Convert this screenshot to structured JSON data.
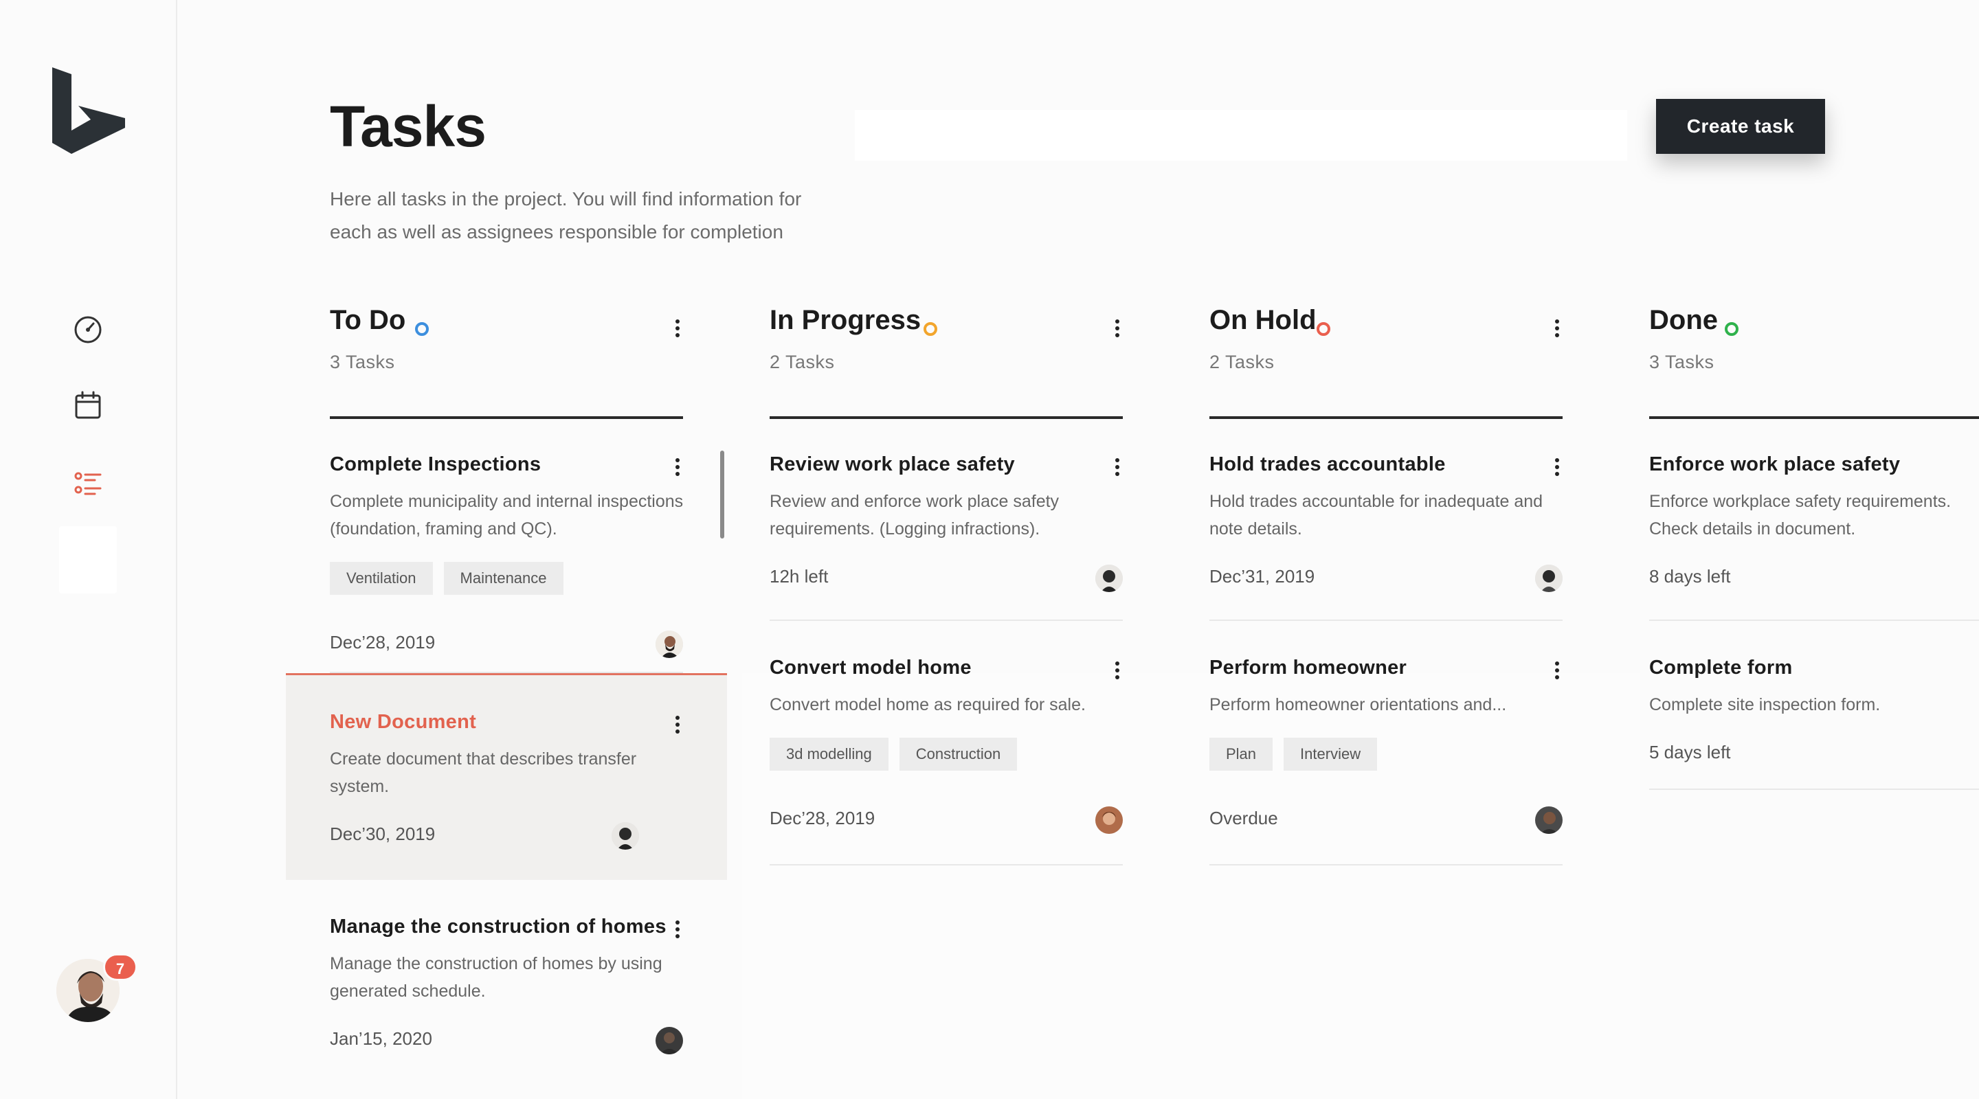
{
  "colors": {
    "accent": "#e2624e",
    "todo": "#3d8fde",
    "in_progress": "#f2a52c",
    "on_hold": "#ea5f4e",
    "done": "#2fb24c",
    "button": "#22262b"
  },
  "sidebar": {
    "icons": [
      "logo-icon",
      "dashboard-gauge-icon",
      "calendar-icon",
      "task-list-icon"
    ],
    "notifications": "7"
  },
  "header": {
    "title": "Tasks",
    "description_line1": "Here all tasks in the project. You will find information for",
    "description_line2": "each as well as assignees responsible for completion",
    "create_button": "Create task"
  },
  "columns": [
    {
      "title": "To Do",
      "count": "3 Tasks",
      "cards": [
        {
          "title": "Complete Inspections",
          "desc": "Complete municipality and internal inspections (foundation, framing and QC).",
          "tags": [
            "Ventilation",
            "Maintenance"
          ],
          "meta": "Dec’28, 2019"
        },
        {
          "title": "New Document",
          "desc": "Create document that describes transfer system.",
          "tags": [],
          "meta": "Dec’30, 2019"
        },
        {
          "title": "Manage the construction of homes",
          "desc": "Manage the construction of homes by using generated schedule.",
          "tags": [],
          "meta": "Jan’15, 2020"
        }
      ]
    },
    {
      "title": "In Progress",
      "count": "2 Tasks",
      "cards": [
        {
          "title": "Review work place safety",
          "desc": "Review and enforce work place safety requirements. (Logging infractions).",
          "tags": [],
          "meta": "12h left"
        },
        {
          "title": "Convert model home",
          "desc": "Convert model home as required for sale.",
          "tags": [
            "3d modelling",
            "Construction"
          ],
          "meta": "Dec’28, 2019"
        }
      ]
    },
    {
      "title": "On Hold",
      "count": "2 Tasks",
      "cards": [
        {
          "title": "Hold trades accountable",
          "desc": "Hold trades accountable for inadequate and note details.",
          "tags": [],
          "meta": "Dec’31, 2019"
        },
        {
          "title": "Perform homeowner",
          "desc": "Perform homeowner orientations and...",
          "tags": [
            "Plan",
            "Interview"
          ],
          "meta": "Overdue"
        }
      ]
    },
    {
      "title": "Done",
      "count": "3 Tasks",
      "cards": [
        {
          "title": "Enforce work place safety",
          "desc": "Enforce workplace safety requirements. Check details in document.",
          "tags": [],
          "meta": "8 days left"
        },
        {
          "title": "Complete form",
          "desc": "Complete site inspection form.",
          "tags": [],
          "meta": "5 days left"
        }
      ]
    }
  ]
}
